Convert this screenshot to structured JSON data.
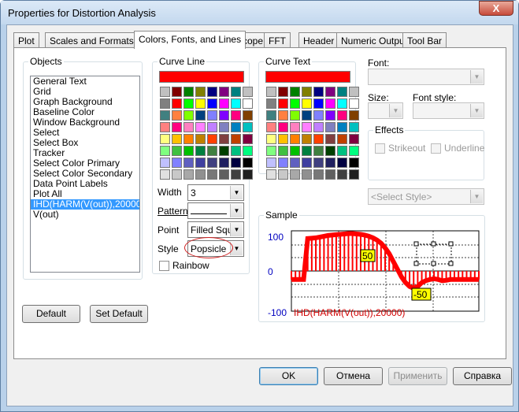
{
  "window": {
    "title": "Properties for Distortion Analysis",
    "close_label": "X"
  },
  "tabs": [
    {
      "label": "Plot"
    },
    {
      "label": "Scales and Formats"
    },
    {
      "label": "Colors, Fonts, and Lines"
    },
    {
      "label": "Scope"
    },
    {
      "label": "FFT"
    },
    {
      "label": "Header"
    },
    {
      "label": "Numeric Output"
    },
    {
      "label": "Tool Bar"
    }
  ],
  "objects": {
    "label": "Objects",
    "items": [
      "General Text",
      "Grid",
      "Graph Background",
      "Baseline Color",
      "Window Background",
      "Select",
      "Select Box",
      "Tracker",
      "Select Color Primary",
      "Select Color Secondary",
      "Data Point Labels",
      "Plot All",
      "IHD(HARM(V(out)),20000)",
      "V(out)"
    ],
    "selected": "IHD(HARM(V(out)),20000)"
  },
  "curve_line": {
    "label": "Curve Line",
    "current_color": "#ff0000",
    "width_label": "Width",
    "width_value": "3",
    "pattern_label": "Pattern",
    "point_label": "Point",
    "point_value": "Filled Squa",
    "style_label": "Style",
    "style_value": "Popsicle",
    "rainbow_label": "Rainbow"
  },
  "curve_text": {
    "label": "Curve Text",
    "current_color": "#ff0000"
  },
  "palette": [
    [
      "#c0c0c0",
      "#800000",
      "#008000",
      "#808000",
      "#000080",
      "#800080",
      "#008080",
      "#c0c0c0"
    ],
    [
      "#808080",
      "#ff0000",
      "#00ff00",
      "#ffff00",
      "#0000ff",
      "#ff00ff",
      "#00ffff",
      "#ffffff"
    ],
    [
      "#408080",
      "#ff8040",
      "#80ff00",
      "#004080",
      "#8080ff",
      "#8000ff",
      "#ff0080",
      "#804000"
    ],
    [
      "#ff8080",
      "#ff0080",
      "#ff80c0",
      "#ff80ff",
      "#c080ff",
      "#8080c0",
      "#0080c0",
      "#00c0c0"
    ],
    [
      "#ffff80",
      "#ffc000",
      "#ff8000",
      "#c08000",
      "#ff4000",
      "#804040",
      "#c04000",
      "#800040"
    ],
    [
      "#80ff80",
      "#40c040",
      "#00c000",
      "#008040",
      "#408040",
      "#004000",
      "#00c080",
      "#00ff80"
    ],
    [
      "#c0c0ff",
      "#8080ff",
      "#6060c0",
      "#4040a0",
      "#404080",
      "#202060",
      "#000040",
      "#000000"
    ],
    [
      "#e0e0e0",
      "#c8c8c8",
      "#a8a8a8",
      "#909090",
      "#787878",
      "#606060",
      "#404040",
      "#202020"
    ]
  ],
  "font": {
    "font_label": "Font:",
    "size_label": "Size:",
    "style_label": "Font style:",
    "effects_label": "Effects",
    "strikeout_label": "Strikeout",
    "underline_label": "Underline",
    "select_style_value": "<Select Style>"
  },
  "sample": {
    "label": "Sample",
    "y_top": "100",
    "y_mid": "0",
    "y_bottom": "-100",
    "curve_name": "IHD(HARM(V(out)),20000)",
    "label_a": "50",
    "label_b": "-50"
  },
  "buttons": {
    "default": "Default",
    "set_default": "Set Default",
    "ok": "OK",
    "cancel": "Отмена",
    "apply": "Применить",
    "help": "Справка"
  }
}
